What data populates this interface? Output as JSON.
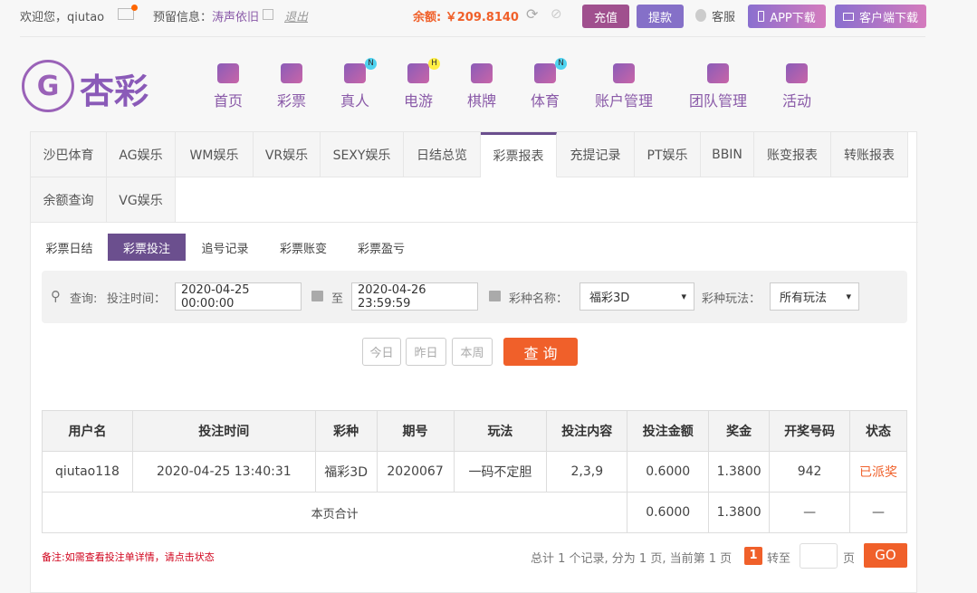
{
  "topbar": {
    "welcome": "欢迎您，qiutao",
    "reserved_label": "预留信息：",
    "reserved_value": "涛声依旧",
    "logout": "退出",
    "balance": "余额: ￥209.8140",
    "recharge": "充值",
    "withdraw": "提款",
    "service": "客服",
    "app_download": "APP下载",
    "client_download": "客户端下载"
  },
  "logo": "杏彩",
  "nav": [
    {
      "label": "首页"
    },
    {
      "label": "彩票"
    },
    {
      "label": "真人",
      "badge": "N"
    },
    {
      "label": "电游",
      "badge": "H"
    },
    {
      "label": "棋牌"
    },
    {
      "label": "体育",
      "badge": "N"
    },
    {
      "label": "账户管理"
    },
    {
      "label": "团队管理"
    },
    {
      "label": "活动"
    }
  ],
  "tabs": [
    "沙巴体育",
    "AG娱乐",
    "WM娱乐",
    "VR娱乐",
    "SEXY娱乐",
    "日结总览",
    "彩票报表",
    "充提记录",
    "PT娱乐",
    "BBIN",
    "账变报表",
    "转账报表",
    "余额查询",
    "VG娱乐"
  ],
  "subtabs": [
    "彩票日结",
    "彩票投注",
    "追号记录",
    "彩票账变",
    "彩票盈亏"
  ],
  "filter": {
    "query": "查询:",
    "time_label": "投注时间：",
    "start": "2020-04-25 00:00:00",
    "to": "至",
    "end": "2020-04-26 23:59:59",
    "lottery_label": "彩种名称：",
    "lottery": "福彩3D",
    "play_label": "彩种玩法：",
    "play": "所有玩法",
    "today": "今日",
    "yesterday": "昨日",
    "week": "本周",
    "search": "查 询"
  },
  "table": {
    "headers": [
      "用户名",
      "投注时间",
      "彩种",
      "期号",
      "玩法",
      "投注内容",
      "投注金额",
      "奖金",
      "开奖号码",
      "状态"
    ],
    "row": [
      "qiutao118",
      "2020-04-25 13:40:31",
      "福彩3D",
      "2020067",
      "一码不定胆",
      "2,3,9",
      "0.6000",
      "1.3800",
      "942",
      "已派奖"
    ],
    "total": {
      "label": "本页合计",
      "amount": "0.6000",
      "prize": "1.3800",
      "num": "—",
      "status": "—"
    }
  },
  "footer": {
    "note": "备注:如需查看投注单详情，请点击状态",
    "summary": "总计 1 个记录, 分为 1 页, 当前第 1 页",
    "page": "1",
    "goto": "转至",
    "page_unit": "页",
    "go": "GO"
  }
}
